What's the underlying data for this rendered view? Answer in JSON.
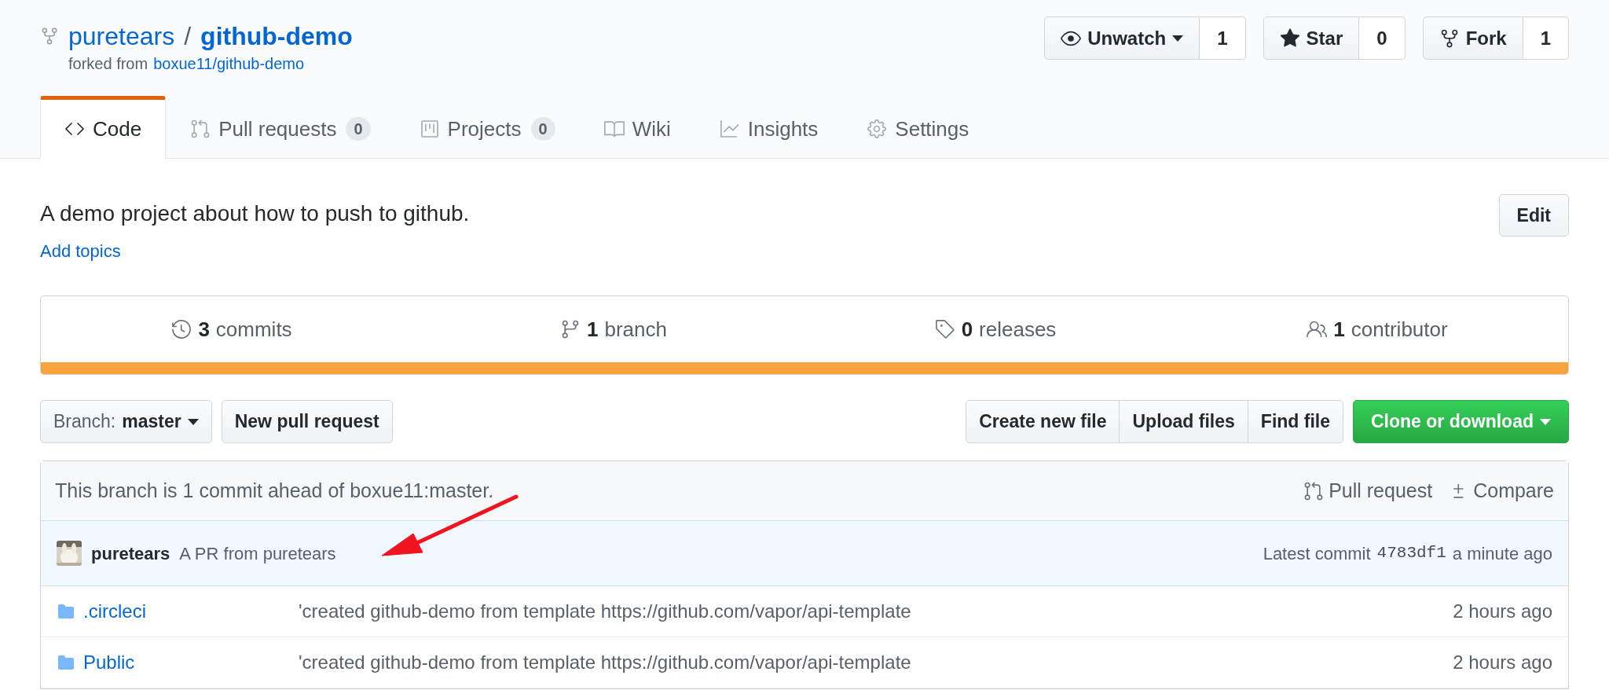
{
  "repo": {
    "owner": "puretears",
    "separator": "/",
    "name": "github-demo",
    "forked_prefix": "forked from",
    "fork_source": "boxue11/github-demo"
  },
  "actions": [
    {
      "kind": "watch",
      "label": "Unwatch",
      "count": "1",
      "dropdown": true
    },
    {
      "kind": "star",
      "label": "Star",
      "count": "0",
      "dropdown": false
    },
    {
      "kind": "fork",
      "label": "Fork",
      "count": "1",
      "dropdown": false
    }
  ],
  "tabs": [
    {
      "kind": "code",
      "label": "Code",
      "selected": true
    },
    {
      "kind": "pulls",
      "label": "Pull requests",
      "count": "0",
      "selected": false
    },
    {
      "kind": "projects",
      "label": "Projects",
      "count": "0",
      "selected": false
    },
    {
      "kind": "wiki",
      "label": "Wiki",
      "selected": false
    },
    {
      "kind": "insights",
      "label": "Insights",
      "selected": false
    },
    {
      "kind": "settings",
      "label": "Settings",
      "selected": false
    }
  ],
  "description": "A demo project about how to push to github.",
  "edit_button": "Edit",
  "add_topics": "Add topics",
  "stats": [
    {
      "kind": "commits",
      "count": "3",
      "label": "commits"
    },
    {
      "kind": "branch",
      "count": "1",
      "label": "branch"
    },
    {
      "kind": "releases",
      "count": "0",
      "label": "releases"
    },
    {
      "kind": "contributors",
      "count": "1",
      "label": "contributor"
    }
  ],
  "branch_button": {
    "prefix": "Branch:",
    "value": "master"
  },
  "new_pull_request": "New pull request",
  "file_buttons": [
    "Create new file",
    "Upload files",
    "Find file"
  ],
  "clone_button": "Clone or download",
  "compare_bar": {
    "message": "This branch is 1 commit ahead of boxue11:master.",
    "links": [
      {
        "kind": "pull",
        "label": "Pull request"
      },
      {
        "kind": "compare",
        "label": "Compare"
      }
    ]
  },
  "latest_commit": {
    "author": "puretears",
    "message": "A PR from puretears",
    "prefix": "Latest commit",
    "sha": "4783df1",
    "time": "a minute ago"
  },
  "files": [
    {
      "name": ".circleci",
      "message": "'created github-demo from template https://github.com/vapor/api-template",
      "age": "2 hours ago"
    },
    {
      "name": "Public",
      "message": "'created github-demo from template https://github.com/vapor/api-template",
      "age": "2 hours ago"
    }
  ]
}
